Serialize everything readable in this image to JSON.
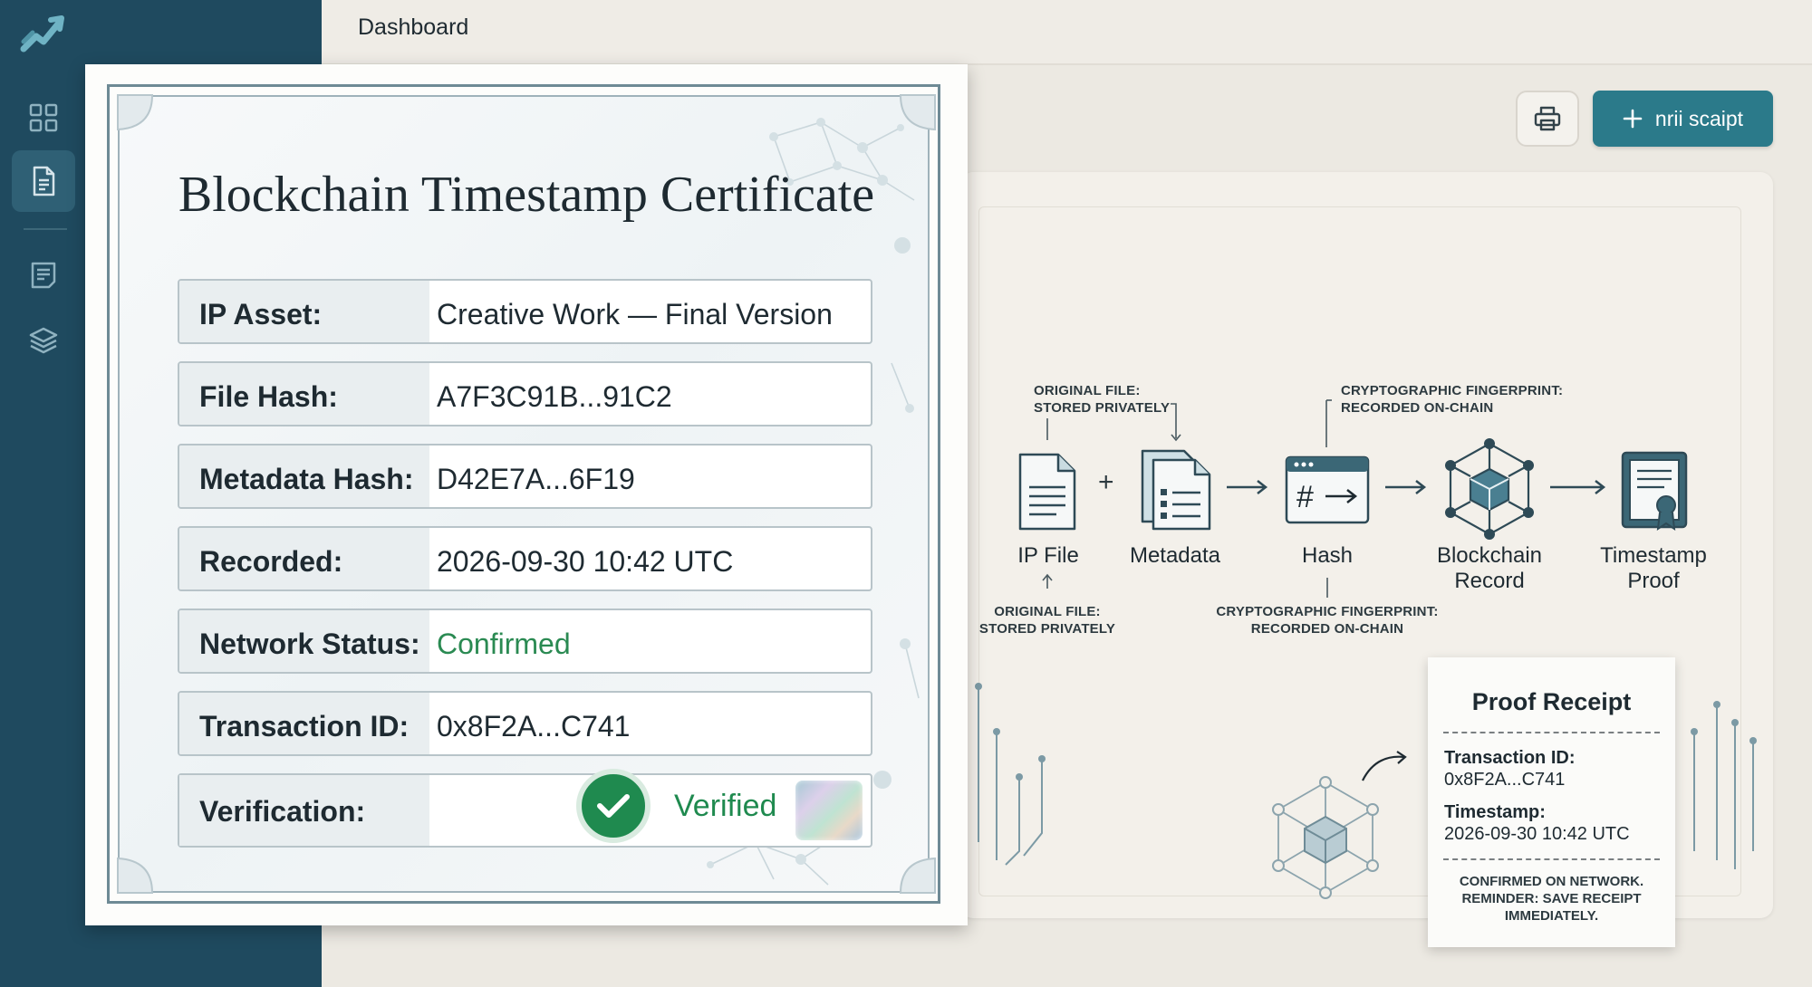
{
  "topbar": {
    "title": "Dashboard"
  },
  "toolbar": {
    "primary_label": "nrii scaipt"
  },
  "sidebar": {
    "items": [
      {
        "name": "grid-icon",
        "active": false
      },
      {
        "name": "document-icon",
        "active": true
      },
      {
        "name": "report-icon",
        "active": false
      },
      {
        "name": "layers-icon",
        "active": false
      }
    ]
  },
  "certificate": {
    "title": "Blockchain Timestamp Certificate",
    "rows": [
      {
        "label": "IP Asset:",
        "value": "Creative Work — Final Version"
      },
      {
        "label": "File Hash:",
        "value": "A7F3C91B...91C2"
      },
      {
        "label": "Metadata Hash:",
        "value": "D42E7A...6F19"
      },
      {
        "label": "Recorded:",
        "value": "2026-09-30 10:42 UTC"
      },
      {
        "label": "Network Status:",
        "value": "Confirmed",
        "color": "#2a8a52"
      },
      {
        "label": "Transaction ID:",
        "value": "0x8F2A...C741"
      }
    ],
    "verification": {
      "label": "Verification:",
      "value": "Verified",
      "color": "#1f8a4f"
    }
  },
  "workflow": {
    "steps": [
      {
        "label": "IP File",
        "icon": "file-icon"
      },
      {
        "label": "Metadata",
        "icon": "metadata-icon"
      },
      {
        "label": "Hash",
        "icon": "hash-icon"
      },
      {
        "label": "Blockchain Record",
        "icon": "blockchain-icon"
      },
      {
        "label": "Timestamp Proof",
        "icon": "certificate-icon"
      }
    ],
    "notes": {
      "original_file": "ORIGINAL FILE:\nSTORED PRIVATELY",
      "fingerprint": "CRYPTOGRAPHIC FINGERPRINT:\nRECORDED ON-CHAIN",
      "original_file_bottom": "ORIGINAL FILE:\nSTORED PRIVATELY",
      "fingerprint_bottom": "CRYPTOGRAPHIC FINGERPRINT:\nRECORDED ON-CHAIN"
    }
  },
  "receipt": {
    "title": "Proof Receipt",
    "tx_label": "Transaction ID:",
    "tx_value": "0x8F2A...C741",
    "ts_label": "Timestamp:",
    "ts_value": "2026-09-30 10:42 UTC",
    "footer": "CONFIRMED ON NETWORK.\nREMINDER: SAVE RECEIPT\nIMMEDIATELY."
  },
  "colors": {
    "sidebar": "#1f4a5f",
    "accent": "#2b7a8a",
    "success": "#1f8a4f"
  }
}
